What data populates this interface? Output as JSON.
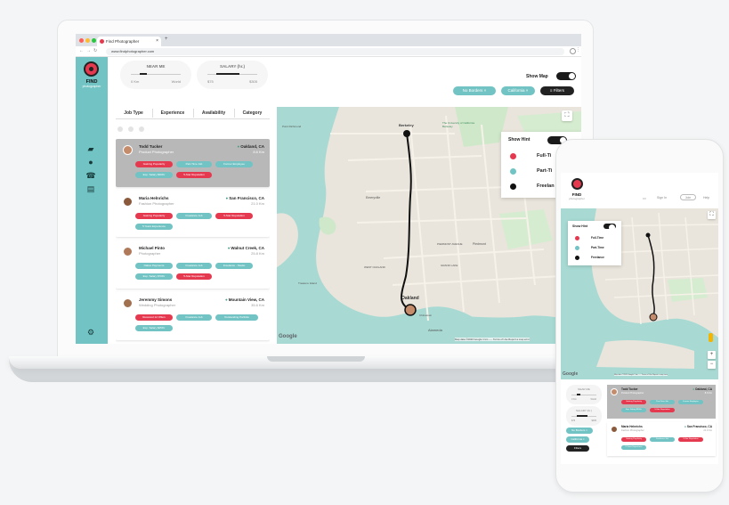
{
  "browser": {
    "tab_title": "Find Photographer",
    "tab_close": "×",
    "new_tab": "+",
    "url": "www.findphotographer.com"
  },
  "brand": {
    "name": "FIND",
    "sub": "photographer",
    "accent": "#e53950",
    "teal": "#72c3c4"
  },
  "sliders": [
    {
      "title": "NEAR ME",
      "min": "0 Km",
      "max": "World"
    },
    {
      "title": "SALARY (hr.)",
      "min": "$75",
      "max": "$305"
    }
  ],
  "show_map_label": "Show Map",
  "filters": {
    "borders": "No Borders ×",
    "state": "California ×",
    "button": "Filters"
  },
  "filter_tabs": [
    "Job Type",
    "Experience",
    "Availability",
    "Category"
  ],
  "candidates": [
    {
      "name": "Todd Tucker",
      "role": "Product Photographer",
      "location": "Oakland, CA",
      "distance": "8.6 Km",
      "selected": true,
      "tags": [
        {
          "text": "Gaining Popularity",
          "color": "red"
        },
        {
          "text": "Part-Time Job",
          "color": "teal"
        },
        {
          "text": "Former Employee",
          "color": "teal"
        },
        {
          "text": "Exp. Salary $30/hr",
          "color": "teal"
        },
        {
          "text": "5-Star Reputation",
          "color": "red"
        }
      ]
    },
    {
      "name": "Maria Helnrichs",
      "role": "Fashion Photographer",
      "location": "San Francisco, CA",
      "distance": "21.0 Km",
      "selected": false,
      "tags": [
        {
          "text": "Gaining Popularity",
          "color": "red"
        },
        {
          "text": "Freelance Job",
          "color": "teal"
        },
        {
          "text": "5-Star Reputation",
          "color": "red"
        },
        {
          "text": "5 Years Experience",
          "color": "teal"
        }
      ]
    },
    {
      "name": "Michael Pinto",
      "role": "Photographer",
      "location": "Walnut Creek, CA",
      "distance": "25.8 Km",
      "selected": false,
      "tags": [
        {
          "text": "Native Payments",
          "color": "teal"
        },
        {
          "text": "Freelance Job",
          "color": "teal"
        },
        {
          "text": "Freelance - Studio",
          "color": "teal"
        },
        {
          "text": "Exp. Salary $70/hr",
          "color": "teal"
        },
        {
          "text": "5-Star Reputation",
          "color": "red"
        }
      ]
    },
    {
      "name": "Jeremmy Simons",
      "role": "Wedding Photographer",
      "location": "Mountain View, CA",
      "distance": "35.6 Km",
      "selected": false,
      "tags": [
        {
          "text": "Received 12 Offers",
          "color": "red"
        },
        {
          "text": "Freelance Job",
          "color": "teal"
        },
        {
          "text": "Outstanding Portfolio",
          "color": "teal"
        },
        {
          "text": "Exp. Salary $25/hr",
          "color": "teal"
        }
      ]
    }
  ],
  "map": {
    "fullscreen_icon": "⛶",
    "hint_title": "Show Hint",
    "legend": [
      {
        "label": "Full-Time",
        "color": "#e53950"
      },
      {
        "label": "Part-Time",
        "color": "#72c3c4"
      },
      {
        "label": "Freelance",
        "color": "#111111"
      }
    ],
    "legend_laptop": [
      "Full-Ti",
      "Part-Ti",
      "Freelan"
    ],
    "places": [
      "Berkeley",
      "The University of California Berkeley",
      "Emeryville",
      "Piedmont",
      "Oakland",
      "Alameda",
      "WEST OAKLAND",
      "GRAND LAKE",
      "Chinatown",
      "PIEDMONT AVENUE",
      "Treasure Island",
      "Point Richmond"
    ],
    "google": "Google",
    "attribution": "Map data ©2020 Google   1 km ⎯⎯⎯   Terms of Use   Report a map error",
    "zoom_in": "+",
    "zoom_out": "−"
  },
  "phone": {
    "nav": [
      "Sign In",
      "Join",
      "Help"
    ],
    "sliders": [
      {
        "title": "NEAR ME",
        "min": "0 Km",
        "max": "World"
      },
      {
        "title": "SALARY (hr.)",
        "min": "$75",
        "max": "$305"
      }
    ],
    "pills": [
      "No Borders ×",
      "California ×",
      "Filters"
    ]
  }
}
